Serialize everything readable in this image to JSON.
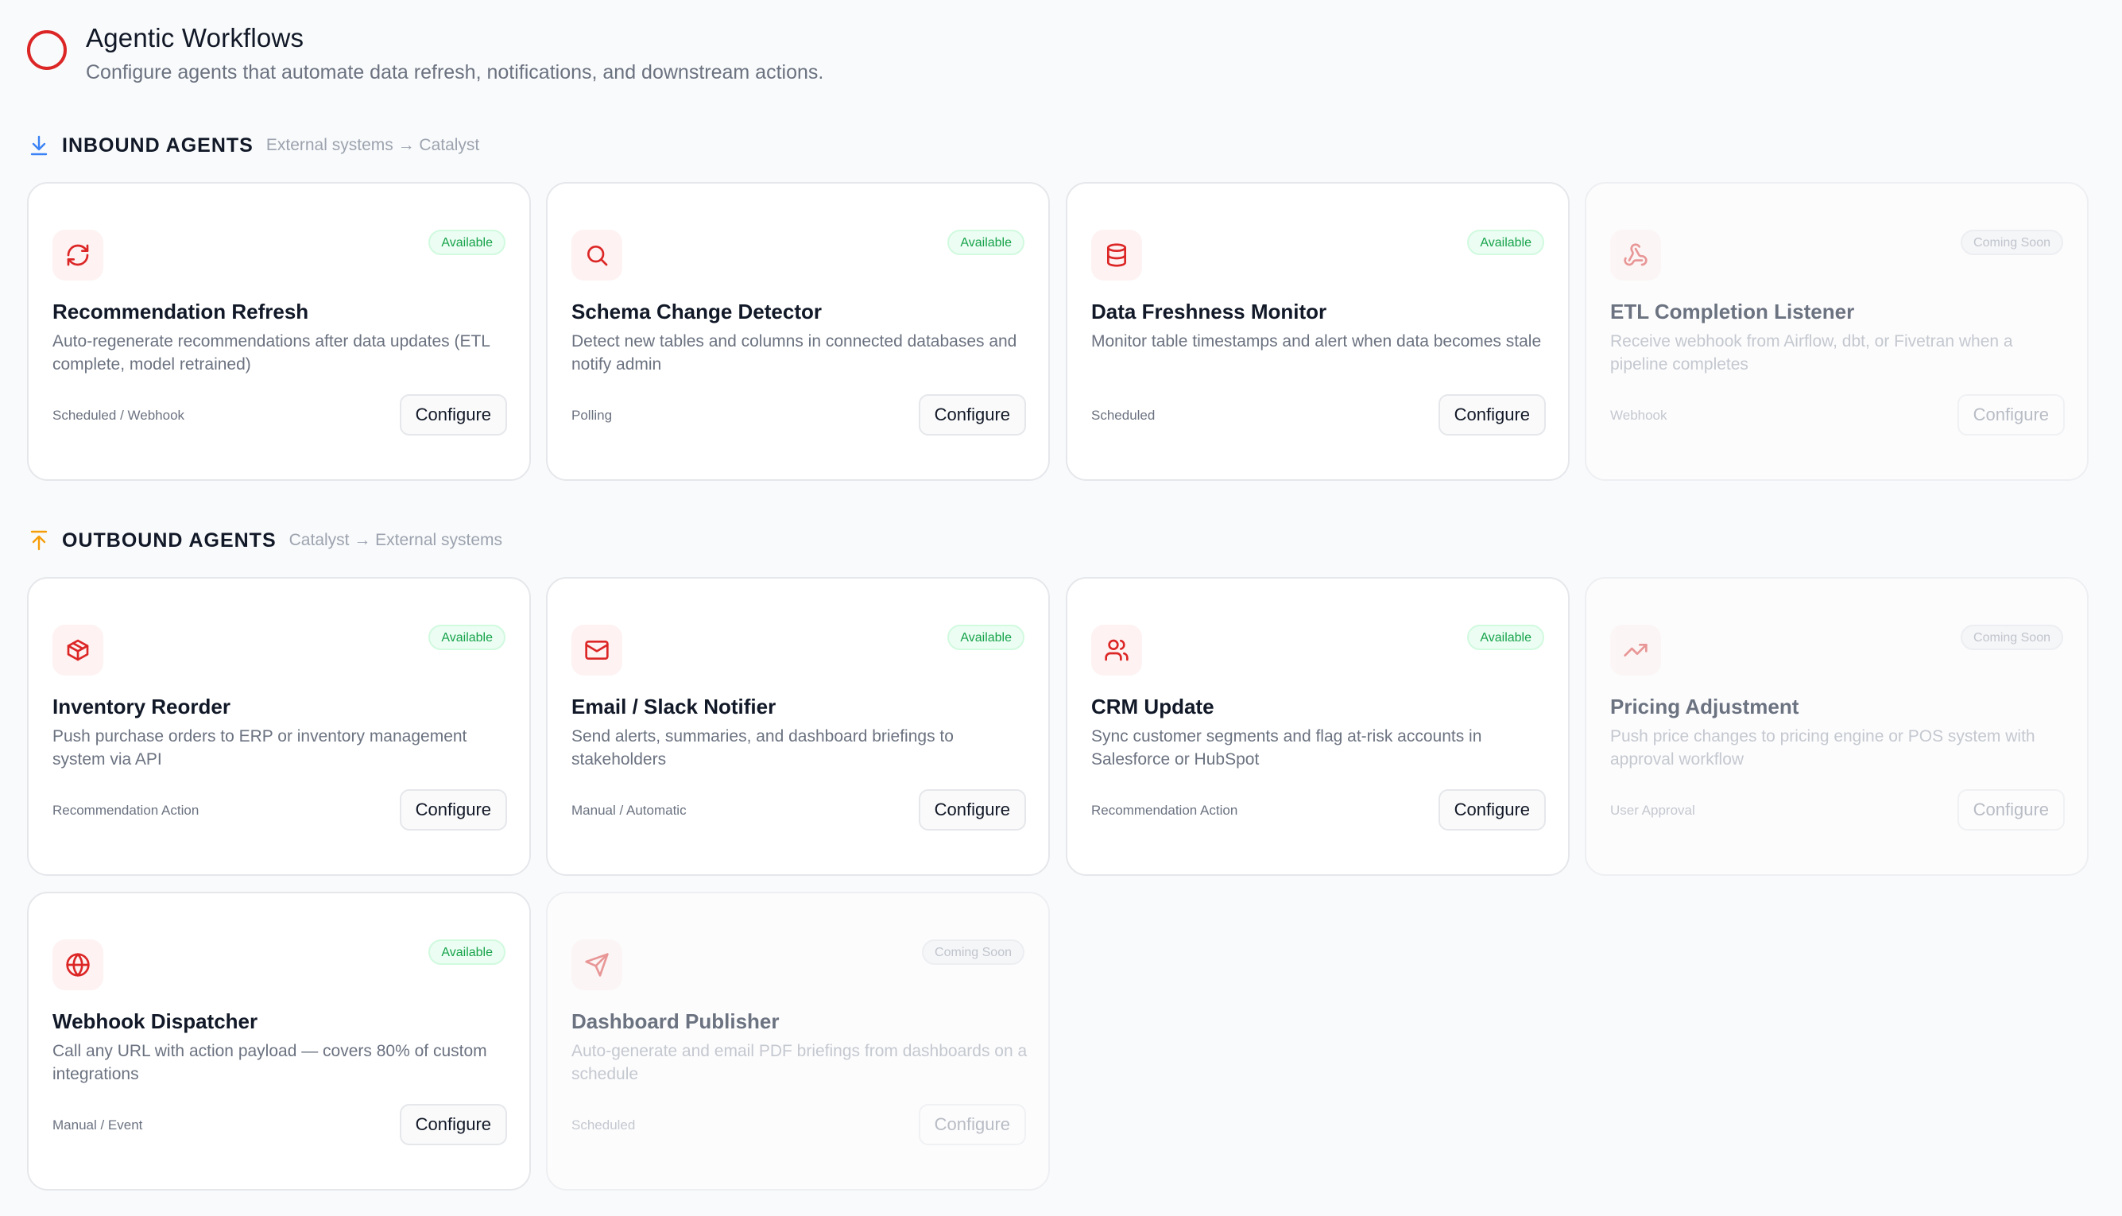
{
  "header": {
    "title": "Agentic Workflows",
    "subtitle": "Configure agents that automate data refresh, notifications, and downstream actions."
  },
  "sections": {
    "inbound": {
      "title": "INBOUND AGENTS",
      "subtitle": "External systems → Catalyst",
      "icon": "arrow-down-to-line-icon",
      "color": "#3b82f6"
    },
    "outbound": {
      "title": "OUTBOUND AGENTS",
      "subtitle": "Catalyst → External systems",
      "icon": "arrow-up-from-line-icon",
      "color": "#f59e0b"
    }
  },
  "colors": {
    "accent": "#dc2626",
    "available": "#16a34a"
  },
  "cards": [
    {
      "title": "Recommendation Refresh",
      "description": "Auto-regenerate recommendations after data updates (ETL complete, model retrained)",
      "trigger": "Scheduled / Webhook",
      "status": "Available",
      "button": "Configure",
      "icon": "refresh-icon"
    },
    {
      "title": "Schema Change Detector",
      "description": "Detect new tables and columns in connected databases and notify admin",
      "trigger": "Polling",
      "status": "Available",
      "button": "Configure",
      "icon": "search-icon"
    },
    {
      "title": "Data Freshness Monitor",
      "description": "Monitor table timestamps and alert when data becomes stale",
      "trigger": "Scheduled",
      "status": "Available",
      "button": "Configure",
      "icon": "database-icon"
    },
    {
      "title": "ETL Completion Listener",
      "description": "Receive webhook from Airflow, dbt, or Fivetran when a pipeline completes",
      "trigger": "Webhook",
      "status": "Coming Soon",
      "button": "Configure",
      "icon": "webhook-icon"
    },
    {
      "title": "Inventory Reorder",
      "description": "Push purchase orders to ERP or inventory management system via API",
      "trigger": "Recommendation Action",
      "status": "Available",
      "button": "Configure",
      "icon": "package-icon"
    },
    {
      "title": "Email / Slack Notifier",
      "description": "Send alerts, summaries, and dashboard briefings to stakeholders",
      "trigger": "Manual / Automatic",
      "status": "Available",
      "button": "Configure",
      "icon": "mail-icon"
    },
    {
      "title": "CRM Update",
      "description": "Sync customer segments and flag at-risk accounts in Salesforce or HubSpot",
      "trigger": "Recommendation Action",
      "status": "Available",
      "button": "Configure",
      "icon": "users-icon"
    },
    {
      "title": "Pricing Adjustment",
      "description": "Push price changes to pricing engine or POS system with approval workflow",
      "trigger": "User Approval",
      "status": "Coming Soon",
      "button": "Configure",
      "icon": "trending-up-icon"
    },
    {
      "title": "Webhook Dispatcher",
      "description": "Call any URL with action payload — covers 80% of custom integrations",
      "trigger": "Manual / Event",
      "status": "Available",
      "button": "Configure",
      "icon": "globe-icon"
    },
    {
      "title": "Dashboard Publisher",
      "description": "Auto-generate and email PDF briefings from dashboards on a schedule",
      "trigger": "Scheduled",
      "status": "Coming Soon",
      "button": "Configure",
      "icon": "send-icon"
    }
  ]
}
